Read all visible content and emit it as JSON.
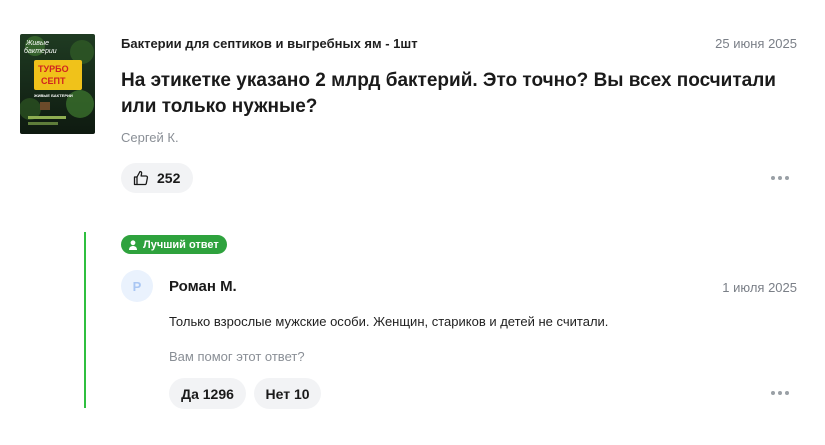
{
  "question": {
    "product_name": "Бактерии для септиков и выгребных ям - 1шт",
    "product_image": {
      "alt_lines": [
        "Живые",
        "бактерии",
        "ТУРБО",
        "СЕПТ",
        "ЖИВЫЕ БАКТЕРИИ"
      ]
    },
    "date": "25 июня 2025",
    "text": "На этикетке указано 2 млрд бактерий. Это точно? Вы всех посчитали или только нужные?",
    "author": "Сергей К.",
    "likes": "252",
    "icons": {
      "like": "thumbs-up-icon",
      "more": "more-dots-icon"
    }
  },
  "answer": {
    "badge": "Лучший ответ",
    "badge_icon": "user-award-icon",
    "avatar_letter": "Р",
    "author": "Роман М.",
    "date": "1 июля 2025",
    "text": "Только взрослые мужские особи. Женщин, стариков и детей не считали.",
    "helpful_question": "Вам помог этот ответ?",
    "vote_yes": "Да 1296",
    "vote_no": "Нет 10",
    "icons": {
      "more": "more-dots-icon"
    }
  },
  "colors": {
    "accent_green": "#2ea23d",
    "line_green": "#2fbf3f",
    "pill_bg": "#f2f3f5",
    "muted_text": "#8a8f96"
  }
}
